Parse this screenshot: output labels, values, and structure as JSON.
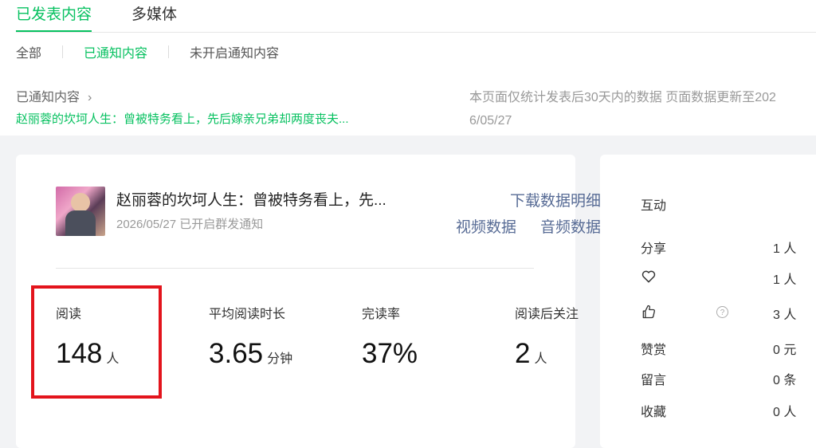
{
  "tabs": [
    {
      "label": "已发表内容"
    },
    {
      "label": "多媒体"
    }
  ],
  "filters": [
    {
      "label": "全部"
    },
    {
      "label": "已通知内容"
    },
    {
      "label": "未开启通知内容"
    }
  ],
  "breadcrumb": {
    "label": "已通知内容",
    "title": "赵丽蓉的坎坷人生：曾被特务看上，先后嫁亲兄弟却两度丧夫..."
  },
  "notice": {
    "line1": "本页面仅统计发表后30天内的数据 页面数据更新至202",
    "line2": "6/05/27"
  },
  "article": {
    "title": "赵丽蓉的坎坷人生：曾被特务看上，先...",
    "subtitle": "2026/05/27 已开启群发通知",
    "download_link": "下载数据明细",
    "video_link": "视频数据",
    "audio_link": "音频数据"
  },
  "metrics": [
    {
      "label": "阅读",
      "value": "148",
      "unit": "人"
    },
    {
      "label": "平均阅读时长",
      "value": "3.65",
      "unit": "分钟"
    },
    {
      "label": "完读率",
      "value": "37%",
      "unit": ""
    },
    {
      "label": "阅读后关注",
      "value": "2",
      "unit": "人"
    }
  ],
  "interaction": {
    "title": "互动",
    "share_label": "分享",
    "share_value": "1 人",
    "like_value": "1 人",
    "thumbs_value": "3 人",
    "reward_label": "赞赏",
    "reward_value": "0 元",
    "comment_label": "留言",
    "comment_value": "0 条",
    "collect_label": "收藏",
    "collect_value": "0 人",
    "help_mark": "?"
  },
  "colors": {
    "accent": "#07c160",
    "link": "#576b95",
    "highlight": "#e3141c"
  }
}
